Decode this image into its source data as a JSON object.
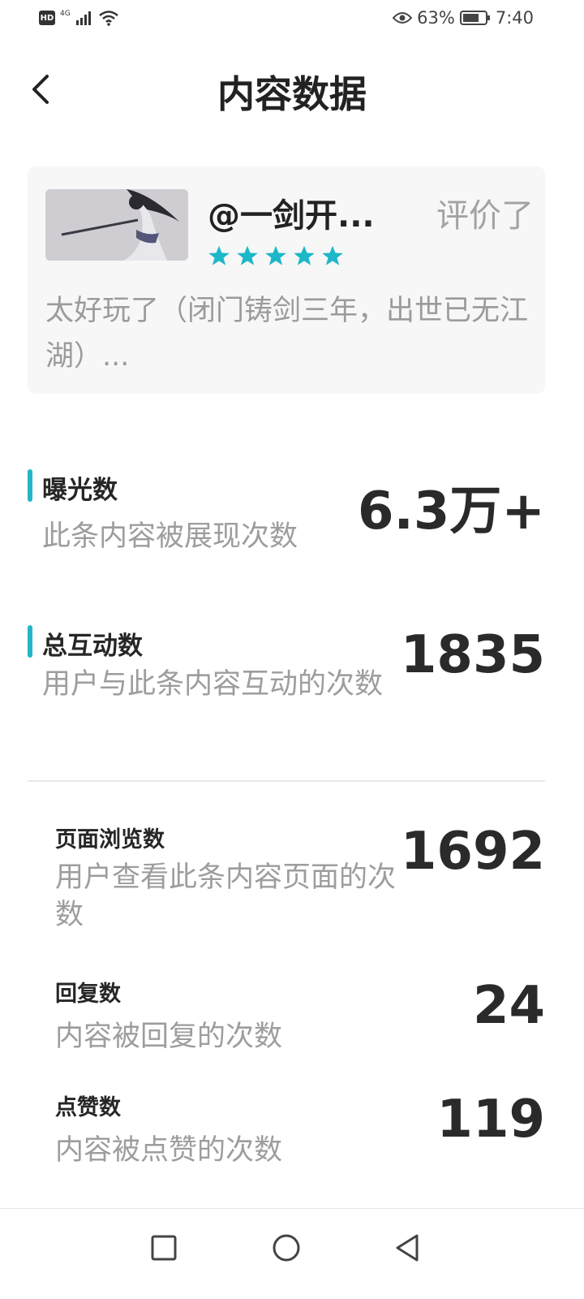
{
  "status_bar": {
    "hd": "HD",
    "network": "4G",
    "battery_pct": "63%",
    "time": "7:40"
  },
  "header": {
    "title": "内容数据"
  },
  "review": {
    "reviewer": "@一剑开...",
    "action": "评价了",
    "rating": 5,
    "text": "太好玩了（闭门铸剑三年，出世已无江湖）..."
  },
  "metrics": {
    "exposure": {
      "title": "曝光数",
      "desc": "此条内容被展现次数",
      "value": "6.3万+"
    },
    "interactions": {
      "title": "总互动数",
      "desc": "用户与此条内容互动的次数",
      "value": "1835"
    },
    "page_views": {
      "title": "页面浏览数",
      "desc": "用户查看此条内容页面的次数",
      "value": "1692"
    },
    "replies": {
      "title": "回复数",
      "desc": "内容被回复的次数",
      "value": "24"
    },
    "likes": {
      "title": "点赞数",
      "desc": "内容被点赞的次数",
      "value": "119"
    }
  },
  "colors": {
    "accent": "#24b6c6",
    "star": "#1cb7c9",
    "card_bg": "#f7f7f7"
  },
  "icons": [
    "back-arrow-icon",
    "eye-icon",
    "battery-icon",
    "wifi-icon",
    "signal-icon",
    "star-icon",
    "nav-square-icon",
    "nav-circle-icon",
    "nav-triangle-icon"
  ]
}
